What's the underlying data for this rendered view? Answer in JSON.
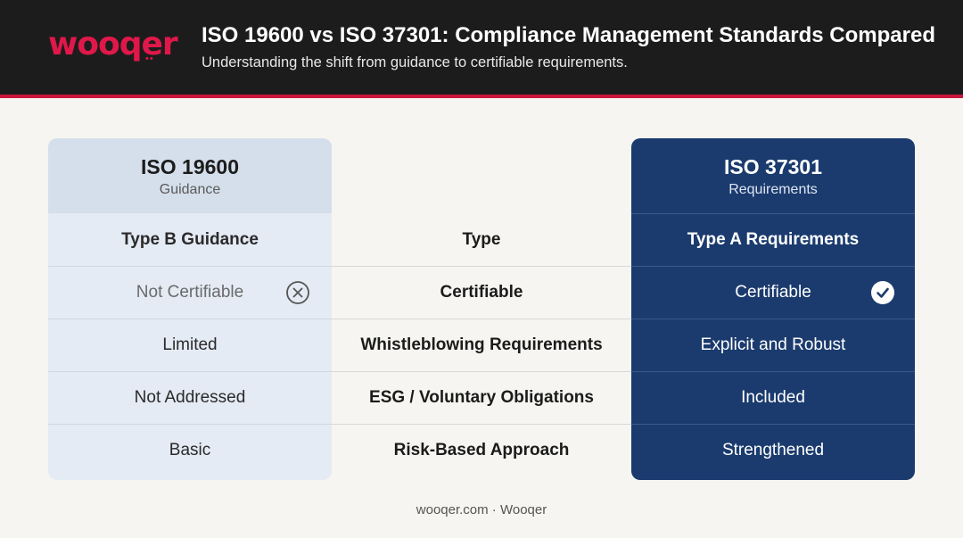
{
  "header": {
    "logo_text": "wooqer",
    "title": "ISO 19600 vs ISO 37301: Compliance Management Standards Compared",
    "subtitle": "Understanding the shift from guidance to certifiable requirements."
  },
  "left_column": {
    "name": "ISO 19600",
    "subtitle": "Guidance",
    "rows": [
      "Type B Guidance",
      "Not Certifiable",
      "Limited",
      "Not Addressed",
      "Basic"
    ]
  },
  "middle_column": {
    "rows": [
      "Type",
      "Certifiable",
      "Whistleblowing Requirements",
      "ESG / Voluntary Obligations",
      "Risk-Based Approach"
    ]
  },
  "right_column": {
    "name": "ISO 37301",
    "subtitle": "Requirements",
    "rows": [
      "Type A Requirements",
      "Certifiable",
      "Explicit and Robust",
      "Included",
      "Strengthened"
    ]
  },
  "icons": {
    "not_certifiable": "x-circle-icon",
    "certifiable": "check-circle-icon"
  },
  "colors": {
    "brand": "#e0184a",
    "header_bg": "#1d1c1c",
    "accent_rule": "#c8163d",
    "left_column_bg": "#e4ebf4",
    "right_column_bg": "#1b3b6e"
  },
  "footer": "wooqer.com · Wooqer"
}
